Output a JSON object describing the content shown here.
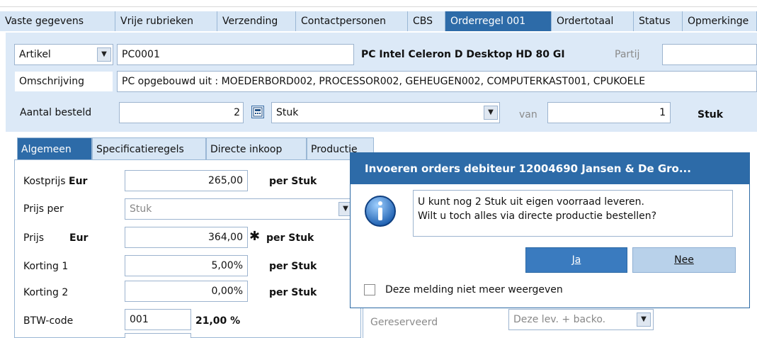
{
  "top_tabs": [
    "Vaste gegevens",
    "Vrije rubrieken",
    "Verzending",
    "Contactpersonen",
    "CBS",
    "Orderregel 001",
    "Ordertotaal",
    "Status",
    "Opmerkinge"
  ],
  "header": {
    "artikel_label": "Artikel",
    "artikel_code": "PC0001",
    "artikel_desc": "PC Intel Celeron D Desktop HD 80 GI",
    "partij_label": "Partij",
    "omschrijving_label": "Omschrijving",
    "omschrijving_value": "PC opgebouwd uit : MOEDERBORD002, PROCESSOR002, GEHEUGEN002, COMPUTERKAST001, CPUKOELE",
    "aantal_label": "Aantal besteld",
    "aantal_value": "2",
    "eenheid": "Stuk",
    "van_label": "van",
    "van_value": "1",
    "van_unit": "Stuk"
  },
  "sub_tabs": [
    "Algemeen",
    "Specificatieregels",
    "Directe inkoop",
    "Productie"
  ],
  "form": {
    "kostprijs_label": "Kostprijs",
    "currency": "Eur",
    "kostprijs_value": "265,00",
    "per_stuk": "per Stuk",
    "prijs_per_label": "Prijs per",
    "prijs_per_value": "Stuk",
    "prijs_label": "Prijs",
    "prijs_value": "364,00",
    "asterisk": "✱",
    "korting1_label": "Korting 1",
    "korting1_value": "5,00%",
    "korting2_label": "Korting 2",
    "korting2_value": "0,00%",
    "btw_label": "BTW-code",
    "btw_value": "001",
    "btw_pct": "21,00 %",
    "gereserveerd_label": "Gereserveerd",
    "gereserveerd_value": "Deze lev. + backo."
  },
  "dialog": {
    "title": "Invoeren orders debiteur 12004690 Jansen & De Gro...",
    "line1": "U kunt nog 2 Stuk uit eigen voorraad leveren.",
    "line2": "Wilt u toch alles via directe productie bestellen?",
    "ja": "Ja",
    "nee": "Nee",
    "checkbox_label": "Deze melding niet meer weergeven"
  }
}
